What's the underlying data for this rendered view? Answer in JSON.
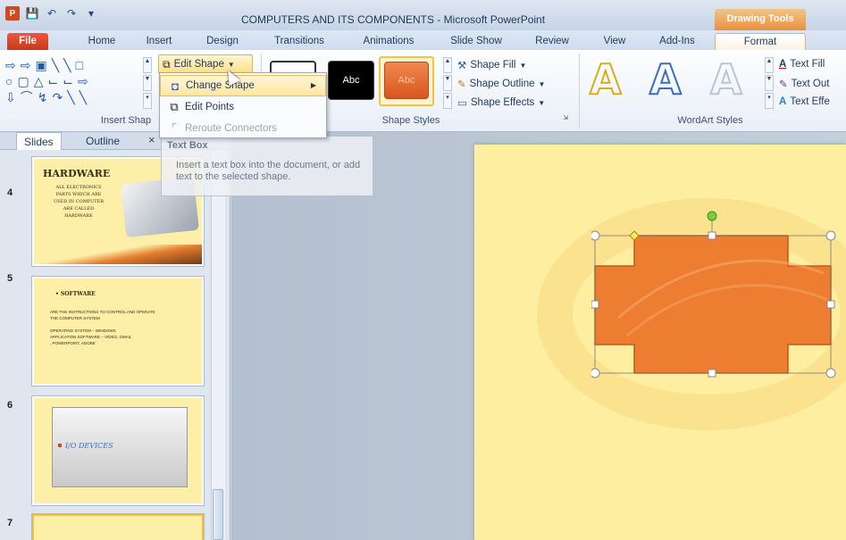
{
  "window": {
    "title": "COMPUTERS AND ITS COMPONENTS - Microsoft PowerPoint",
    "contextual_tab": "Drawing Tools"
  },
  "tabs": [
    "File",
    "Home",
    "Insert",
    "Design",
    "Transitions",
    "Animations",
    "Slide Show",
    "Review",
    "View",
    "Add-Ins",
    "Format"
  ],
  "active_tab": "Format",
  "ribbon": {
    "insert_shapes_label": "Insert Shap",
    "edit_shape_label": "Edit Shape",
    "shape_styles_label": "Shape Styles",
    "style_samples": [
      "Abc",
      "Abc"
    ],
    "shape_fill": "Shape Fill",
    "shape_outline": "Shape Outline",
    "shape_effects": "Shape Effects",
    "wordart_label": "WordArt Styles",
    "wordart_samples": [
      "A",
      "A",
      "A"
    ],
    "text_fill": "Text Fill",
    "text_outline": "Text Out",
    "text_effects": "Text Effe"
  },
  "edit_shape_menu": [
    {
      "label": "Change Shape",
      "icon": "change-shape-icon",
      "has_submenu": true
    },
    {
      "label": "Edit Points",
      "icon": "edit-points-icon",
      "has_submenu": false
    },
    {
      "label": "Reroute Connectors",
      "icon": "reroute-connectors-icon",
      "has_submenu": false,
      "disabled": true
    }
  ],
  "tooltip": {
    "title": "Text Box",
    "body": "Insert a text box into the document, or add text to the selected shape."
  },
  "slide_panel": {
    "tabs": [
      "Slides",
      "Outline"
    ],
    "slides": [
      {
        "number": "4",
        "title": "HARDWARE",
        "body": "ALL ELECTRONICS\nPARTS WHICH ARE\nUSED IN COMPUTER\nARE CALLED\nHARDWARE"
      },
      {
        "number": "5",
        "title": "• SOFTWARE",
        "body": "ARE THE INSTRUCTIONS TO CONTROL AND OPERATE\nTHE COMPUTER SYSTEM\n\nOPERATING SYSTEM – WINDOWS\nAPPLICATION SOFTWARE – VIDEO, GMAIL\n, POWERPOINT, ADOBE"
      },
      {
        "number": "6",
        "title": "I/O DEVICES",
        "body": ""
      },
      {
        "number": "7",
        "title": "",
        "body": ""
      }
    ]
  },
  "colors": {
    "accent_orange": "#ed7d31",
    "slide_bg": "#fdeea0",
    "file_tab": "#d3411f"
  }
}
